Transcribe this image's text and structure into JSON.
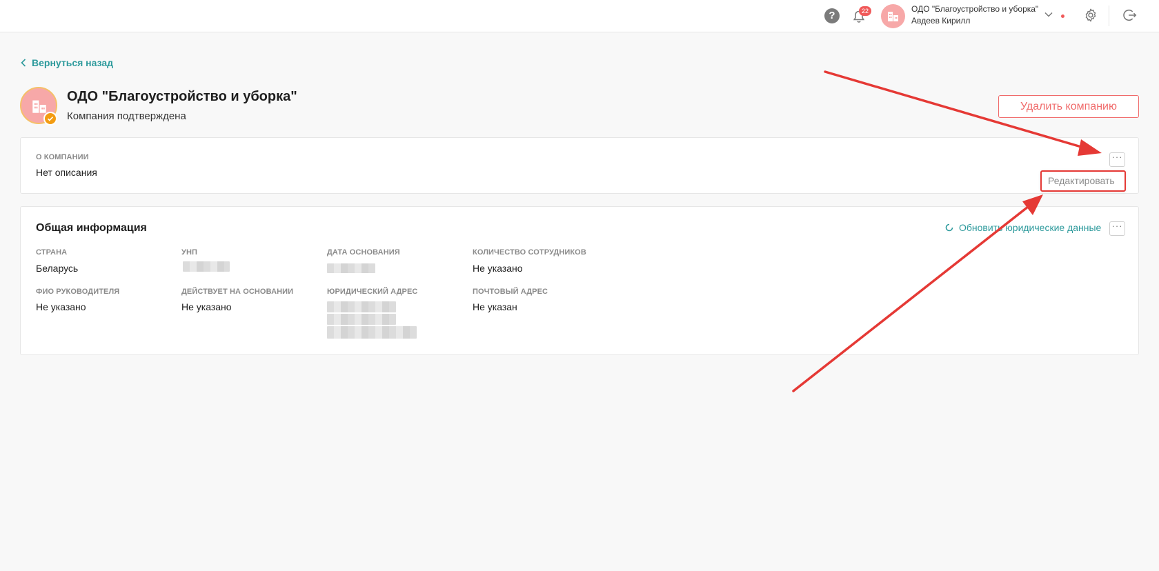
{
  "topbar": {
    "notifications_count": "22",
    "user_company": "ОДО \"Благоустройство и уборка\"",
    "user_name": "Авдеев Кирилл",
    "icons": [
      "help-icon",
      "bell-icon",
      "building-icon",
      "chevron-down-icon",
      "gear-icon",
      "logout-icon"
    ]
  },
  "back_link": "Вернуться назад",
  "company": {
    "name": "ОДО \"Благоустройство и уборка\"",
    "status": "Компания подтверждена",
    "delete_label": "Удалить компанию"
  },
  "about": {
    "label": "О КОМПАНИИ",
    "value": "Нет описания",
    "menu_button": "···",
    "menu_item": "Редактировать"
  },
  "general": {
    "title": "Общая информация",
    "refresh_label": "Обновить юридические данные",
    "menu_button": "···",
    "fields": [
      {
        "label": "СТРАНА",
        "value": "Беларусь"
      },
      {
        "label": "УНП",
        "value": ""
      },
      {
        "label": "ДАТА ОСНОВАНИЯ",
        "value": ""
      },
      {
        "label": "КОЛИЧЕСТВО СОТРУДНИКОВ",
        "value": "Не указано"
      },
      {
        "label": "ФИО РУКОВОДИТЕЛЯ",
        "value": "Не указано"
      },
      {
        "label": "ДЕЙСТВУЕТ НА ОСНОВАНИИ",
        "value": "Не указано"
      },
      {
        "label": "ЮРИДИЧЕСКИЙ АДРЕС",
        "value": ""
      },
      {
        "label": "ПОЧТОВЫЙ АДРЕС",
        "value": "Не указан"
      }
    ]
  },
  "colors": {
    "accent": "#2d9a9c",
    "danger": "#f06b6b",
    "annotation": "#e53935",
    "avatar": "#f7a8a8",
    "verified": "#f39c12"
  }
}
